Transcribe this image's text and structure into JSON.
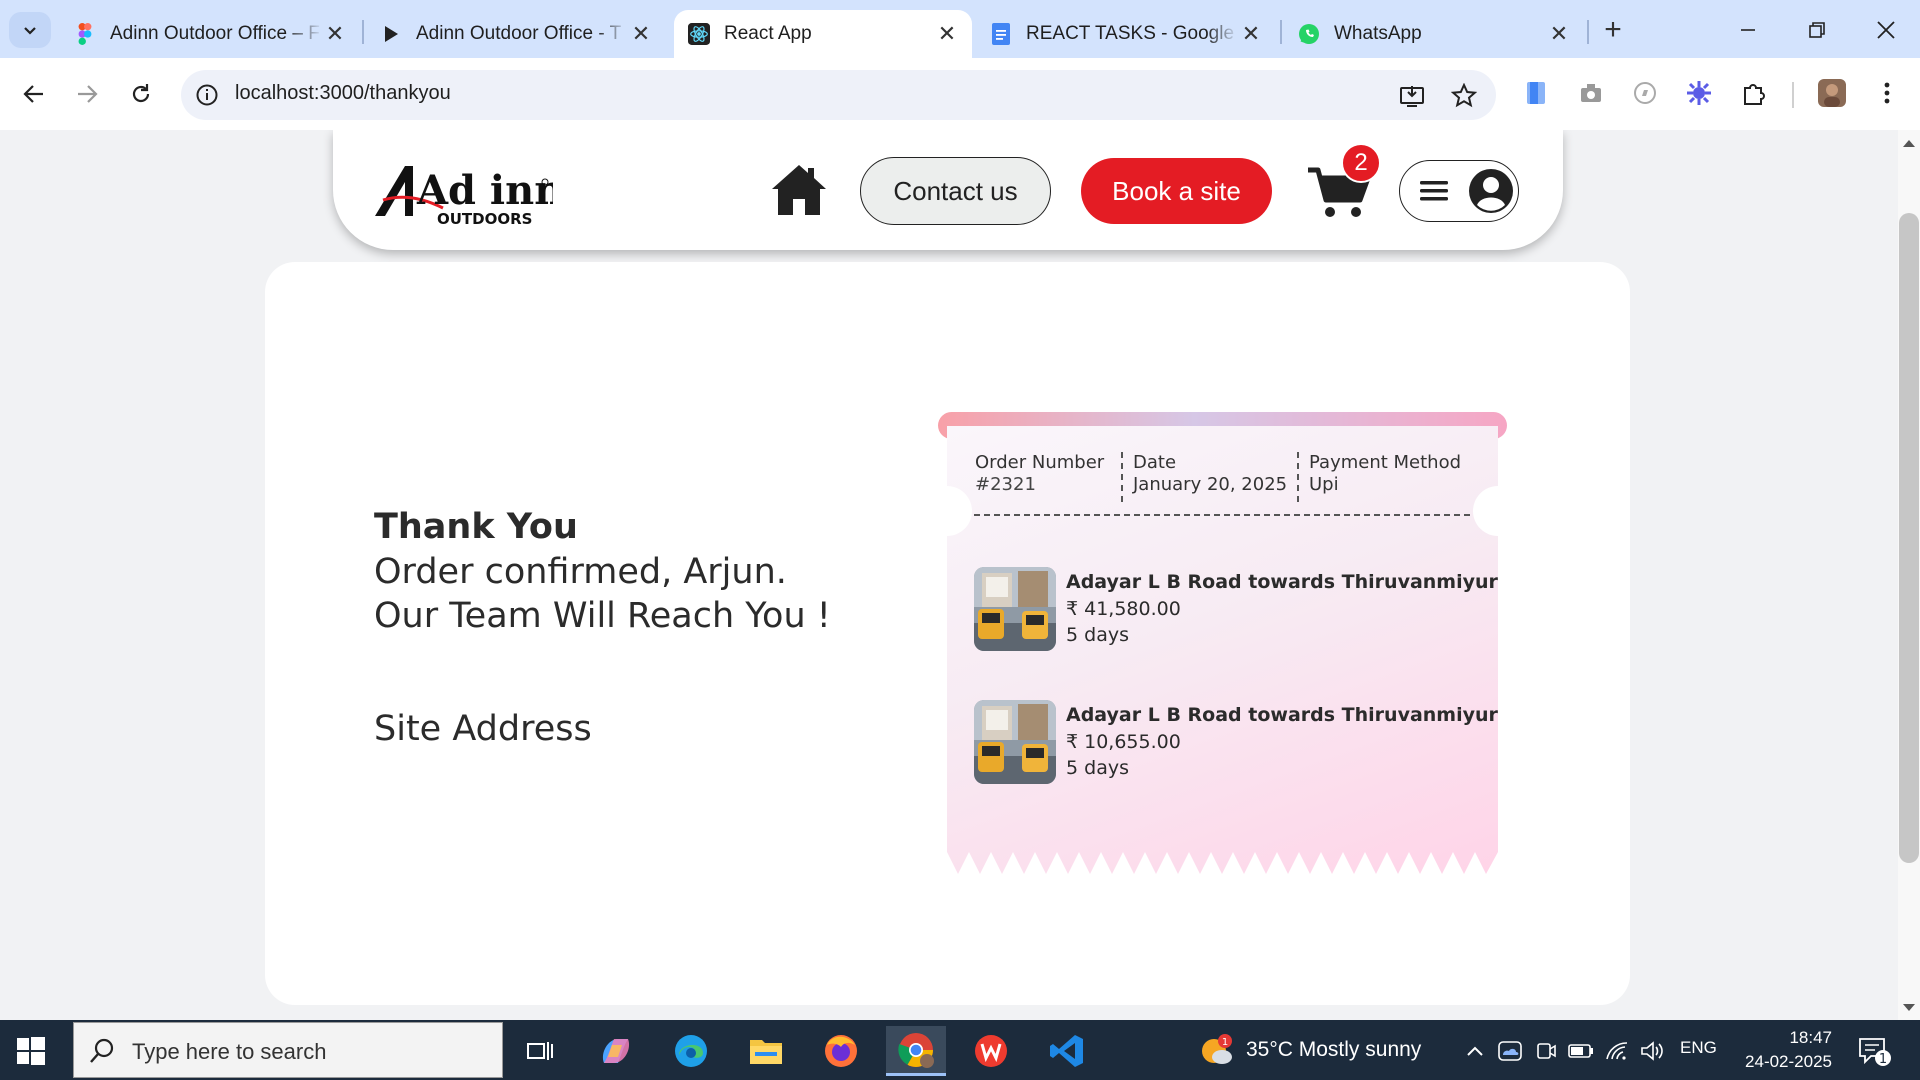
{
  "browser": {
    "tabs": [
      {
        "label": "Adinn Outdoor Office – F",
        "icon": "figma-icon"
      },
      {
        "label": "Adinn Outdoor Office - T",
        "icon": "play-icon"
      },
      {
        "label": "React App",
        "icon": "react-icon",
        "active": true
      },
      {
        "label": "REACT TASKS - Google D",
        "icon": "google-docs-icon"
      },
      {
        "label": "WhatsApp",
        "icon": "whatsapp-icon"
      }
    ],
    "url": "localhost:3000/thankyou"
  },
  "header": {
    "logo_text_top": "Ad inn",
    "logo_text_bottom": "OUTDOORS",
    "contact_label": "Contact us",
    "book_label": "Book a site",
    "cart_count": "2"
  },
  "confirmation": {
    "title": "Thank You",
    "line1": "Order confirmed, Arjun.",
    "line2": "Our Team Will Reach You !",
    "site_address_label": "Site Address"
  },
  "receipt": {
    "order_number_label": "Order Number",
    "order_number": "#2321",
    "date_label": "Date",
    "date": "January 20, 2025",
    "payment_label": "Payment Method",
    "payment": "Upi",
    "items": [
      {
        "name": "Adayar L B Road towards Thiruvanmiyur",
        "price": "₹ 41,580.00",
        "duration": "5 days"
      },
      {
        "name": "Adayar L B Road towards Thiruvanmiyur",
        "price": "₹ 10,655.00",
        "duration": "5 days"
      }
    ]
  },
  "taskbar": {
    "search_placeholder": "Type here to search",
    "weather": "35°C  Mostly sunny",
    "weather_badge": "1",
    "language": "ENG",
    "time": "18:47",
    "date": "24-02-2025",
    "notification_count": "1"
  },
  "colors": {
    "brand_red": "#e41c24",
    "tab_strip": "#d3e3fd",
    "taskbar": "#1c2b3c"
  }
}
